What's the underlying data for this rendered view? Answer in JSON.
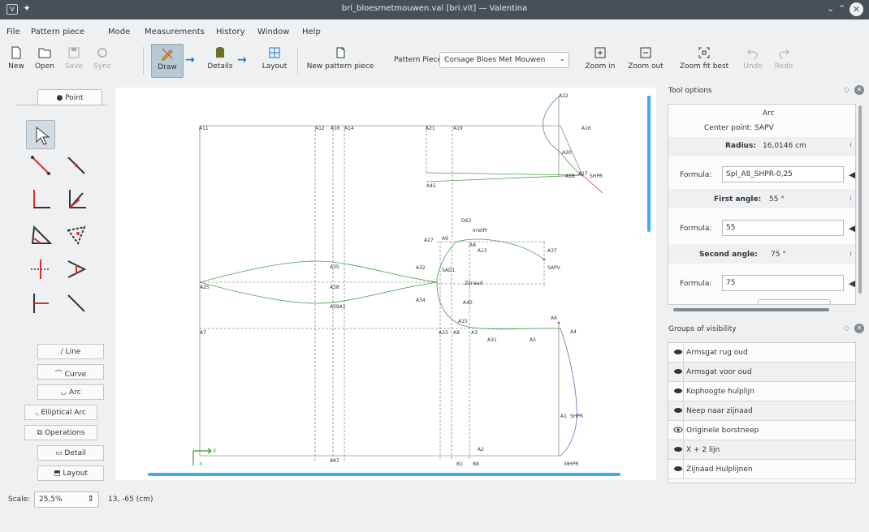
{
  "window": {
    "title": "bri_bloesmetmouwen.val [bri.vit] — Valentina",
    "app_icon_text": "V",
    "colors": {
      "accent": "#3daee9",
      "titlebar": "#475057",
      "active_tool": "#b7c9d4"
    }
  },
  "menu": [
    "File",
    "Pattern piece",
    "Mode",
    "Measurements",
    "History",
    "Window",
    "Help"
  ],
  "toolbar": {
    "new": "New",
    "open": "Open",
    "save": "Save",
    "sync": "Sync",
    "draw": "Draw",
    "details": "Details",
    "layout": "Layout",
    "new_pattern_piece": "New pattern piece",
    "pattern_piece_label": "Pattern Piece:",
    "pattern_piece_value": "Corsage Bloes Met Mouwen",
    "zoom_in": "Zoom in",
    "zoom_out": "Zoom out",
    "zoom_fit_best": "Zoom fit best",
    "undo": "Undo",
    "redo": "Redo"
  },
  "toolbox": {
    "point_tab": "Point",
    "categories": [
      "Line",
      "Curve",
      "Arc",
      "Elliptical Arc",
      "Operations",
      "Detail",
      "Layout"
    ]
  },
  "canvas": {
    "point_labels": {
      "A22": "A22",
      "A11": "A11",
      "A12": "A12",
      "A16": "A16",
      "A14": "A14",
      "A21": "A21",
      "A19": "A19",
      "A16b": "A16",
      "A20": "A20",
      "A45": "A45",
      "A18": "A18",
      "A17": "A17",
      "SHPR": "SHPR",
      "D62": "D62",
      "IrretPr": "IrretPr",
      "A27": "A27",
      "A9": "A9",
      "A8b": "A8",
      "A13": "A13",
      "A37": "A37",
      "SAPV": "SAPV",
      "A35": "A35",
      "A32": "A32",
      "SAD1": "SAD1",
      "A25": "A25",
      "A38": "A38",
      "Zijnaad": "Zijnaad",
      "A39A1": "A39A1",
      "A34": "A34",
      "A40": "A40",
      "A15": "A15",
      "A6": "A6",
      "A7": "A7",
      "A33": "A33",
      "A8": "A8",
      "A3": "A3",
      "A31": "A31",
      "A5": "A5",
      "A4": "A4",
      "A1": "A1",
      "SHPR2": "SHPR",
      "A47": "A47",
      "A2": "A2",
      "B1": "B1",
      "B8": "B8",
      "MHPR": "MHPR",
      "axis_x": "X",
      "axis_y": "X"
    }
  },
  "tool_options": {
    "header": "Tool options",
    "tool_name": "Arc",
    "center_point": "Center point:  SAPV",
    "radius_label": "Radius:",
    "radius_value": "16,0146 cm",
    "formula_label": "Formula:",
    "radius_formula": "Spl_A8_SHPR-0,25",
    "first_angle_label": "First angle:",
    "first_angle_value": "55 °",
    "first_angle_formula": "55",
    "second_angle_label": "Second angle:",
    "second_angle_value": "75 °",
    "second_angle_formula": "75"
  },
  "groups": {
    "header": "Groups of visibility",
    "items": [
      {
        "name": "Armsgat rug oud",
        "eye": "eye-closed-icon"
      },
      {
        "name": "Armsgat voor oud",
        "eye": "eye-closed-icon"
      },
      {
        "name": "Kophoogte hulplijn",
        "eye": "eye-closed-icon"
      },
      {
        "name": "Neep naar zijnaad",
        "eye": "eye-closed-icon"
      },
      {
        "name": "Originele borstneep",
        "eye": "eye-open-icon"
      },
      {
        "name": "X + 2 lijn",
        "eye": "eye-closed-icon"
      },
      {
        "name": "Zijnaad Hulplijnen",
        "eye": "eye-closed-icon"
      }
    ]
  },
  "status": {
    "scale_label": "Scale:",
    "scale_value": "25,5%",
    "coords": "13, -65 (cm)"
  }
}
